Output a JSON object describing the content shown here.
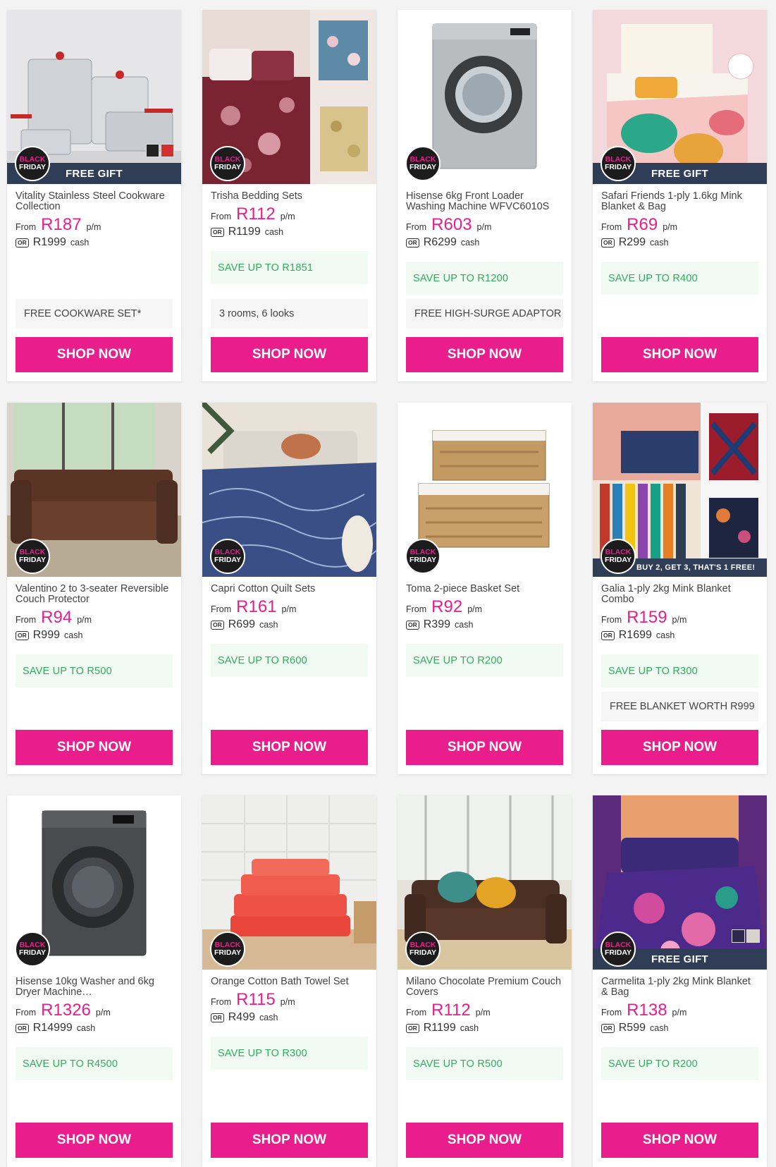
{
  "badge": {
    "line1": "BLACK",
    "line2": "FRIDAY"
  },
  "labels": {
    "from": "From",
    "pm": "p/m",
    "or": "OR",
    "cash": "cash",
    "shop": "SHOP NOW"
  },
  "colors": {
    "accent": "#e91e8c",
    "banner": "#2f3e56",
    "save_text": "#2eae5b"
  },
  "products": [
    {
      "title": "Vitality Stainless Steel Cookware Collection",
      "price": "R187",
      "cash": "R1999",
      "save": "",
      "perk": "FREE COOKWARE SET*",
      "banner": "FREE GIFT",
      "swatches": [
        "#222222",
        "#d32f2f"
      ]
    },
    {
      "title": "Trisha Bedding Sets",
      "price": "R112",
      "cash": "R1199",
      "save": "SAVE UP TO R1851",
      "perk": "3 rooms, 6 looks",
      "banner": "",
      "swatches": []
    },
    {
      "title": "Hisense 6kg Front Loader Washing Machine WFVC6010S",
      "price": "R603",
      "cash": "R6299",
      "save": "SAVE UP TO R1200",
      "perk": "FREE HIGH-SURGE ADAPTOR",
      "banner": "",
      "swatches": []
    },
    {
      "title": "Safari Friends 1-ply 1.6kg Mink Blanket & Bag",
      "price": "R69",
      "cash": "R299",
      "save": "SAVE UP TO R400",
      "perk": "",
      "banner": "FREE GIFT",
      "swatches": []
    },
    {
      "title": "Valentino 2 to 3-seater Reversible Couch Protector",
      "price": "R94",
      "cash": "R999",
      "save": "SAVE UP TO R500",
      "perk": "",
      "banner": "",
      "swatches": []
    },
    {
      "title": "Capri Cotton Quilt Sets",
      "price": "R161",
      "cash": "R699",
      "save": "SAVE UP TO R600",
      "perk": "",
      "banner": "",
      "swatches": []
    },
    {
      "title": "Toma 2-piece Basket Set",
      "price": "R92",
      "cash": "R399",
      "save": "SAVE UP TO R200",
      "perk": "",
      "banner": "",
      "swatches": []
    },
    {
      "title": "Galia 1-ply 2kg Mink Blanket Combo",
      "price": "R159",
      "cash": "R1699",
      "save": "SAVE UP TO R300",
      "perk": "FREE BLANKET WORTH R999",
      "banner": "BUY 2, GET 3, THAT'S 1 FREE!",
      "swatches": []
    },
    {
      "title": "Hisense 10kg Washer and 6kg Dryer Machine…",
      "price": "R1326",
      "cash": "R14999",
      "save": "SAVE UP TO R4500",
      "perk": "",
      "banner": "",
      "swatches": []
    },
    {
      "title": "Orange Cotton Bath Towel Set",
      "price": "R115",
      "cash": "R499",
      "save": "SAVE UP TO R300",
      "perk": "",
      "banner": "",
      "swatches": []
    },
    {
      "title": "Milano Chocolate Premium Couch Covers",
      "price": "R112",
      "cash": "R1199",
      "save": "SAVE UP TO R500",
      "perk": "",
      "banner": "",
      "swatches": []
    },
    {
      "title": "Carmelita 1-ply 2kg Mink Blanket & Bag",
      "price": "R138",
      "cash": "R599",
      "save": "SAVE UP TO R200",
      "perk": "",
      "banner": "FREE GIFT",
      "swatches": [
        "#2b2a4c",
        "#d8d4cc"
      ]
    }
  ]
}
